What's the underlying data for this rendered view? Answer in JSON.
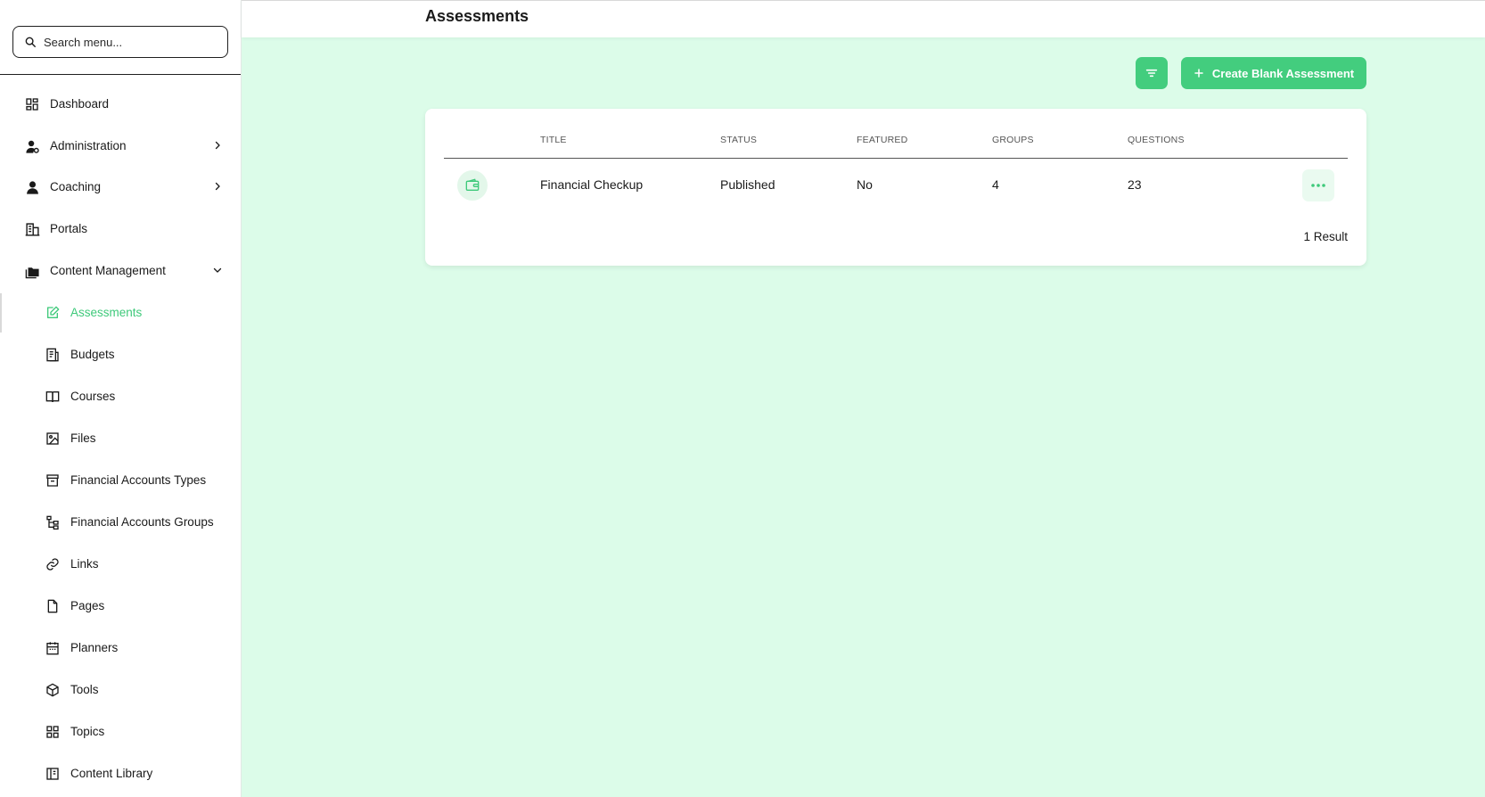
{
  "sidebar": {
    "search_placeholder": "Search menu...",
    "items": [
      {
        "label": "Dashboard"
      },
      {
        "label": "Administration"
      },
      {
        "label": "Coaching"
      },
      {
        "label": "Portals"
      },
      {
        "label": "Content Management"
      }
    ],
    "sub_items": [
      {
        "label": "Assessments"
      },
      {
        "label": "Budgets"
      },
      {
        "label": "Courses"
      },
      {
        "label": "Files"
      },
      {
        "label": "Financial Accounts Types"
      },
      {
        "label": "Financial Accounts Groups"
      },
      {
        "label": "Links"
      },
      {
        "label": "Pages"
      },
      {
        "label": "Planners"
      },
      {
        "label": "Tools"
      },
      {
        "label": "Topics"
      },
      {
        "label": "Content Library"
      }
    ]
  },
  "header": {
    "title": "Assessments"
  },
  "toolbar": {
    "create_label": "Create Blank Assessment"
  },
  "table": {
    "columns": [
      "Title",
      "Status",
      "Featured",
      "Groups",
      "Questions"
    ],
    "rows": [
      {
        "title": "Financial Checkup",
        "status": "Published",
        "featured": "No",
        "groups": "4",
        "questions": "23"
      }
    ],
    "result_count": "1 Result"
  },
  "colors": {
    "accent": "#43cd7e",
    "background": "#dcfce9"
  }
}
